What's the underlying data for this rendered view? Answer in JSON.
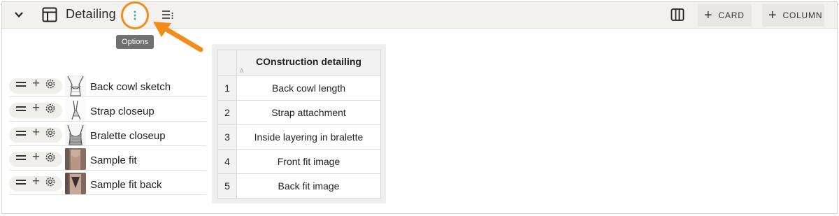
{
  "header": {
    "title": "Detailing",
    "tooltip": "Options",
    "card_label": "CARD",
    "column_label": "COLUMN",
    "accent_color": "#f28c1b"
  },
  "rows": [
    {
      "label": "Back cowl sketch",
      "thumb": "sketch"
    },
    {
      "label": "Strap closeup",
      "thumb": "sketch-strap"
    },
    {
      "label": "Bralette closeup",
      "thumb": "sketch"
    },
    {
      "label": "Sample fit",
      "thumb": "photo"
    },
    {
      "label": "Sample fit back",
      "thumb": "photo-back"
    }
  ],
  "table": {
    "column_header": "COnstruction detailing",
    "column_letter": "A",
    "rows": [
      {
        "index": "1",
        "value": "Back cowl length"
      },
      {
        "index": "2",
        "value": "Strap attachment"
      },
      {
        "index": "3",
        "value": "Inside layering in bralette"
      },
      {
        "index": "4",
        "value": "Front fit image"
      },
      {
        "index": "5",
        "value": "Back fit image"
      }
    ]
  }
}
